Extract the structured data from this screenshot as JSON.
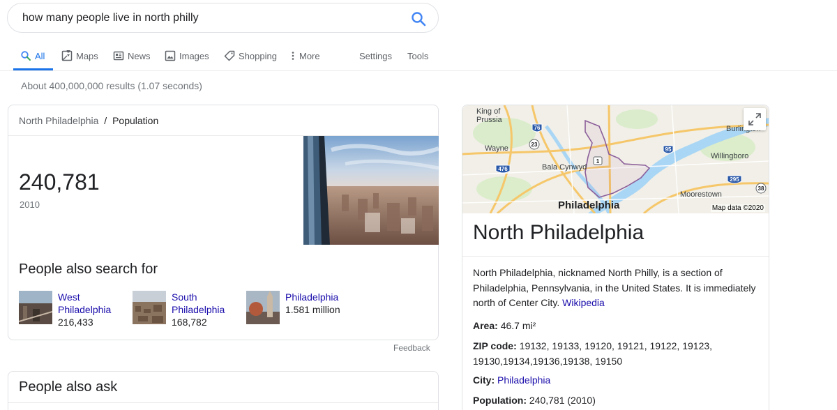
{
  "search": {
    "query": "how many people live in north philly"
  },
  "tabs": [
    {
      "label": "All",
      "icon": "search-icon"
    },
    {
      "label": "Maps",
      "icon": "map-icon"
    },
    {
      "label": "News",
      "icon": "news-icon"
    },
    {
      "label": "Images",
      "icon": "image-icon"
    },
    {
      "label": "Shopping",
      "icon": "tag-icon"
    },
    {
      "label": "More",
      "icon": "more-vert-icon"
    }
  ],
  "tools": {
    "settings": "Settings",
    "tools": "Tools"
  },
  "result_stats": "About 400,000,000 results (1.07 seconds)",
  "population_card": {
    "breadcrumb_place": "North Philadelphia",
    "breadcrumb_sep": "/",
    "breadcrumb_topic": "Population",
    "value": "240,781",
    "year": "2010"
  },
  "people_also_search": {
    "title": "People also search for",
    "items": [
      {
        "name_line1": "West",
        "name_line2": "Philadelphia",
        "value": "216,433"
      },
      {
        "name_line1": "South",
        "name_line2": "Philadelphia",
        "value": "168,782"
      },
      {
        "name_line1": "Philadelphia",
        "name_line2": "",
        "value": "1.581 million"
      }
    ]
  },
  "feedback": "Feedback",
  "people_also_ask": {
    "title": "People also ask"
  },
  "knowledge_panel": {
    "map_labels": {
      "king_of_prussia_1": "King of",
      "king_of_prussia_2": "Prussia",
      "wayne": "Wayne",
      "bala_cynwyd": "Bala Cynwyd",
      "philadelphia": "Philadelphia",
      "burlington": "Burlington",
      "willingboro": "Willingboro",
      "moorestown": "Moorestown",
      "route_76": "76",
      "route_23": "23",
      "route_476": "476",
      "route_1": "1",
      "route_95": "95",
      "route_295": "295",
      "route_38": "38"
    },
    "map_attribution": "Map data ©2020",
    "title": "North Philadelphia",
    "description": "North Philadelphia, nicknamed North Philly, is a section of Philadelphia, Pennsylvania, in the United States. It is immediately north of Center City.",
    "source_link": "Wikipedia",
    "facts": [
      {
        "label": "Area:",
        "value": "46.7 mi²"
      },
      {
        "label": "ZIP code:",
        "value": "19132, 19133, 19120, 19121, 19122, 19123, 19130,19134,19136,19138, 19150"
      },
      {
        "label": "City:",
        "value": "Philadelphia"
      },
      {
        "label": "Population:",
        "value": "240,781 (2010)"
      }
    ]
  },
  "colors": {
    "accent": "#1a73e8",
    "link": "#1a0dab",
    "muted": "#70757a"
  }
}
